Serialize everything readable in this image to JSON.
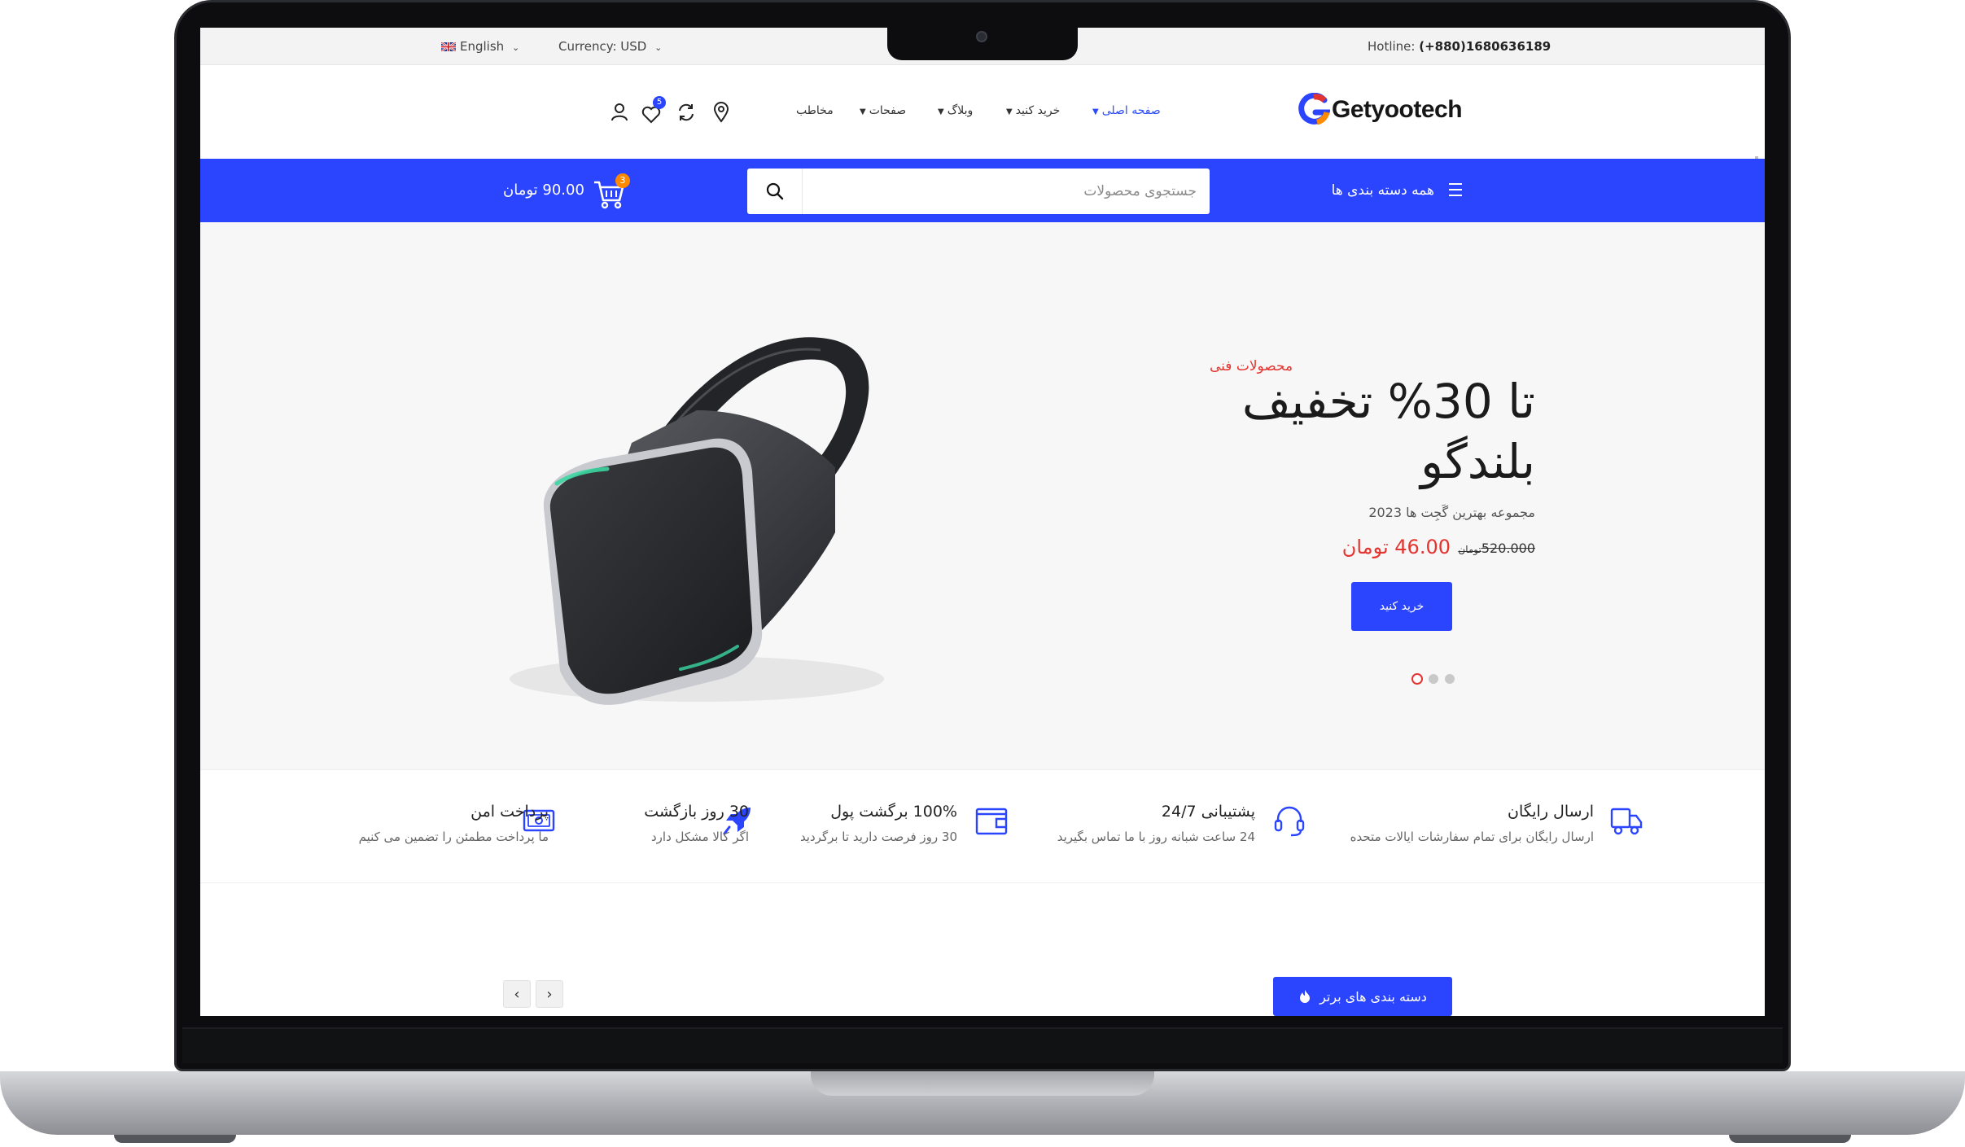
{
  "topbar": {
    "language": "English",
    "currency": "Currency: USD",
    "hotline_label": "Hotline: ",
    "hotline_number": "(+880)1680636189"
  },
  "brand": {
    "name": "Getyootech",
    "colors": {
      "blue": "#2b45ff",
      "orange": "#ff8a00",
      "red": "#e5342f"
    }
  },
  "nav": {
    "items": [
      {
        "label": "صفحه اصلی",
        "dropdown": true,
        "active": true
      },
      {
        "label": "خرید کنید",
        "dropdown": true,
        "active": false
      },
      {
        "label": "وبلاگ",
        "dropdown": true,
        "active": false
      },
      {
        "label": "صفحات",
        "dropdown": true,
        "active": false
      },
      {
        "label": "مخاطب",
        "dropdown": false,
        "active": false
      }
    ],
    "wishlist_count": "5"
  },
  "bluebar": {
    "categories_label": "همه دسته بندی ها",
    "search_placeholder": "جستجوی محصولات",
    "cart_count": "3",
    "cart_total": "90.00 تومان"
  },
  "hero": {
    "tagline": "محصولات فنی",
    "headline_line1": "تا 30% تخفیف",
    "headline_line2": "بلندگو",
    "subtitle": "مجموعه بهترین گَجِت ها 2023",
    "old_price": "520.000",
    "old_price_currency": "تومان",
    "new_price": "46.00 تومان",
    "cta_label": "خرید کنید",
    "slides": 3,
    "active_slide": 1
  },
  "features": [
    {
      "title": "ارسال رایگان",
      "subtitle": "ارسال رایگان برای تمام سفارشات ایالات متحده",
      "icon": "truck-icon"
    },
    {
      "title": "پشتیبانی 24/7",
      "subtitle": "24 ساعت شبانه روز با ما تماس بگیرید",
      "icon": "headset-icon"
    },
    {
      "title": "100% برگشت پول",
      "subtitle": "30 روز فرصت دارید تا برگردید",
      "icon": "wallet-icon"
    },
    {
      "title": "30 روز بازگشت",
      "subtitle": "اگر کالا مشکل دارد",
      "icon": "rocket-icon"
    },
    {
      "title": "پرداخت امن",
      "subtitle": "ما پرداخت مطمئن را تضمین می کنیم",
      "icon": "payment-icon"
    }
  ],
  "categories_section": {
    "title": "دسته بندی های برتر"
  }
}
